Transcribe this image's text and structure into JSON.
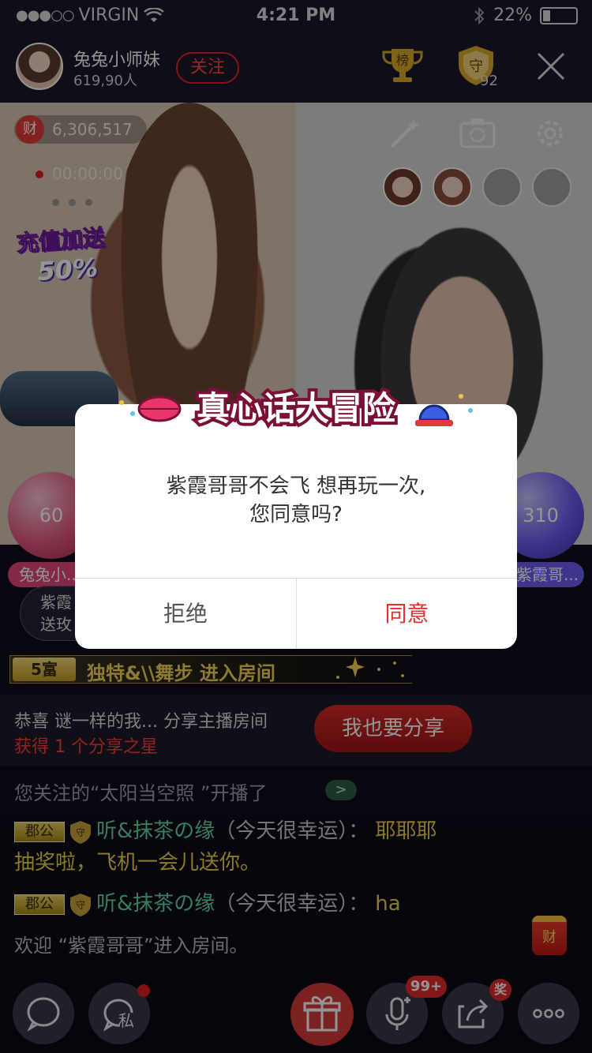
{
  "status_bar": {
    "carrier": "VIRGIN",
    "time": "4:21 PM",
    "battery": "22%",
    "battery_level": 0.22
  },
  "header": {
    "host_name": "兔兔小师妹",
    "host_count": "619,90人",
    "follow_label": "关注",
    "rank_label": "榜",
    "guard_label": "守",
    "guard_count": "92"
  },
  "video": {
    "wealth_icon": "财",
    "wealth_value": "6,306,517",
    "timer": "00:00:00",
    "promo_line1": "充值加送",
    "promo_line2": "50%",
    "left_score": "60",
    "right_score": "310",
    "left_name": "兔兔小...",
    "right_name": "紫霞哥...",
    "gift_card_line1": "紫霞",
    "gift_card_line2": "送玫"
  },
  "chat": {
    "rich_badge": "5富",
    "entry_text": "独特&\\\\舞步  进入房间",
    "share_line1": "恭喜 谜一样的我... 分享主播房间",
    "share_line2": "获得 1 个分享之星",
    "share_button": "我也要分享",
    "notice": "您关注的“太阳当空照 ”开播了",
    "notice_arrow": ">",
    "club_label": "郡公",
    "guard_label": "守",
    "msg1_user": "听&抹茶の缘",
    "msg1_note": "（今天很幸运）：",
    "msg1_text_a": "耶耶耶",
    "msg1_text_b": "抽奖啦，飞机一会儿送你。",
    "msg2_user": "听&抹茶の缘",
    "msg2_note": "（今天很幸运）：",
    "msg2_text": "ha",
    "welcome": "欢迎 “紫霞哥哥”进入房间。",
    "red_packet": "财"
  },
  "bottom_bar": {
    "private_label": "私",
    "mic_badge": "99+",
    "share_badge": "奖"
  },
  "modal": {
    "title": "真心话大冒险",
    "message_line1": "紫霞哥哥不会飞 想再玩一次,",
    "message_line2": "您同意吗?",
    "reject_label": "拒绝",
    "agree_label": "同意"
  },
  "colors": {
    "accent_red": "#e03232",
    "chat_user_green": "#5fd8a5",
    "gold": "#f0d347"
  }
}
